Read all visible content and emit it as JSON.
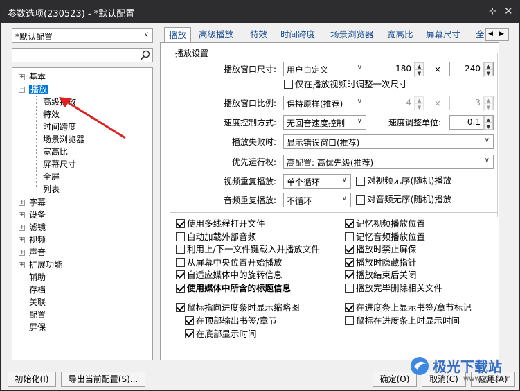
{
  "window": {
    "title": "参数选项(230523) - *默认配置",
    "pin_glyph": "⊹",
    "close_glyph": "✕"
  },
  "left": {
    "profile_combo": "*默认配置",
    "search_placeholder": "",
    "tree": [
      {
        "label": "基本",
        "expander": "+"
      },
      {
        "label": "播放",
        "expander": "−"
      },
      {
        "label": "高级播放"
      },
      {
        "label": "特效"
      },
      {
        "label": "时间跨度"
      },
      {
        "label": "场景浏览器"
      },
      {
        "label": "宽高比"
      },
      {
        "label": "屏幕尺寸"
      },
      {
        "label": "全屏"
      },
      {
        "label": "列表"
      },
      {
        "label": "字幕",
        "expander": "+"
      },
      {
        "label": "设备",
        "expander": "+"
      },
      {
        "label": "滤镜",
        "expander": "+"
      },
      {
        "label": "视频",
        "expander": "+"
      },
      {
        "label": "声音",
        "expander": "+"
      },
      {
        "label": "扩展功能",
        "expander": "+"
      },
      {
        "label": "辅助"
      },
      {
        "label": "存档"
      },
      {
        "label": "关联"
      },
      {
        "label": "配置"
      },
      {
        "label": "屏保"
      }
    ]
  },
  "tabs": [
    "播放",
    "高级播放",
    "特效",
    "时间跨度",
    "场景浏览器",
    "宽高比",
    "屏幕尺寸",
    "全"
  ],
  "group_title": "播放设置",
  "form": {
    "window_size_label": "播放窗口尺寸:",
    "window_size_value": "用户自定义",
    "width": "180",
    "times": "×",
    "height": "240",
    "only_adjust_once": "仅在播放视频时调整一次尺寸",
    "ratio_label": "播放窗口比例:",
    "ratio_value": "保持原样(推荐)",
    "ratio_w": "4",
    "ratio_h": "3",
    "speed_mode_label": "速度控制方式:",
    "speed_mode_value": "无回音速度控制",
    "speed_unit_label": "速度调整单位:",
    "speed_unit_value": "0.1",
    "fail_label": "播放失败时:",
    "fail_value": "显示错误窗口(推荐)",
    "priority_label": "优先运行权:",
    "priority_value": "高配置: 高优先级(推荐)",
    "video_repeat_label": "视频重复播放:",
    "video_repeat_value": "单个循环",
    "video_shuffle": "对视频无序(随机)播放",
    "audio_repeat_label": "音频重复播放:",
    "audio_repeat_value": "不循环",
    "audio_shuffle": "对音频无序(随机)播放"
  },
  "options": [
    {
      "label": "使用多线程打开文件",
      "checked": true
    },
    {
      "label": "记忆视频播放位置",
      "checked": true
    },
    {
      "label": "自动加载外部音频",
      "checked": false
    },
    {
      "label": "记忆音频播放位置",
      "checked": false
    },
    {
      "label": "利用上/下一文件键载入并播放文件",
      "checked": false
    },
    {
      "label": "播放时禁止屏保",
      "checked": true
    },
    {
      "label": "从屏幕中央位置开始播放",
      "checked": false
    },
    {
      "label": "播放时隐藏指针",
      "checked": true
    },
    {
      "label": "自适应媒体中的旋转信息",
      "checked": true
    },
    {
      "label": "播放结束后关闭",
      "checked": true
    },
    {
      "label": "使用媒体中所含的标题信息",
      "checked": true
    },
    {
      "label": "播放完毕删除相关文件",
      "checked": false
    }
  ],
  "options2": [
    {
      "label": "鼠标指向进度条时显示缩略图",
      "checked": true
    },
    {
      "label": "在进度条上显示书签/章节标记",
      "checked": true
    },
    {
      "label": "在顶部输出书签/章节",
      "checked": true
    },
    {
      "label": "鼠标在进度条上时显示时间",
      "checked": false
    },
    {
      "label": "在底部显示时间",
      "checked": true
    }
  ],
  "buttons": {
    "init": "初始化(I)",
    "export": "导出当前配置(S)...",
    "ok": "确定(O)",
    "cancel": "取消(C)",
    "apply": "应用(A)"
  },
  "watermark": "极光下载站",
  "watermark_url": "www.xz7.com",
  "colors": {
    "selection": "#0078d7",
    "arrow": "#e02020",
    "tab_text": "#1b4f94"
  }
}
